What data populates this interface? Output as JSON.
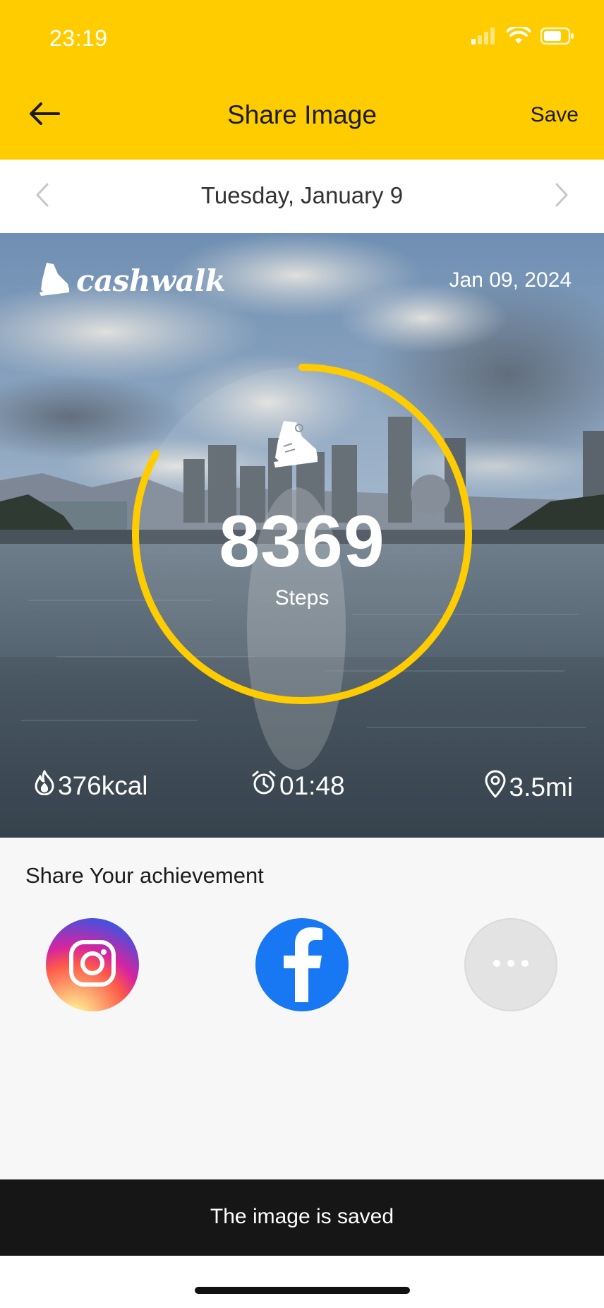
{
  "status_bar": {
    "time": "23:19",
    "icons": [
      "signal-icon",
      "wifi-icon",
      "battery-icon"
    ]
  },
  "nav": {
    "title": "Share Image",
    "save_label": "Save",
    "back_icon": "arrow-left-icon"
  },
  "date_bar": {
    "date": "Tuesday, January 9",
    "prev_icon": "chevron-left-icon",
    "next_icon": "chevron-right-icon"
  },
  "card": {
    "brand": "cashwalk",
    "date": "Jan 09, 2024",
    "steps_value": "8369",
    "steps_label": "Steps",
    "ring_progress_fraction": 0.83,
    "ring_color": "#ffcc00",
    "stats": {
      "calories": "376kcal",
      "duration": "01:48",
      "distance": "3.5mi"
    }
  },
  "share": {
    "title": "Share Your achievement",
    "options": [
      "instagram-icon",
      "facebook-icon",
      "more-icon"
    ]
  },
  "toast": {
    "message": "The image is saved"
  },
  "colors": {
    "accent": "#ffcc00",
    "facebook": "#1877f2",
    "toast_bg": "#161616"
  }
}
